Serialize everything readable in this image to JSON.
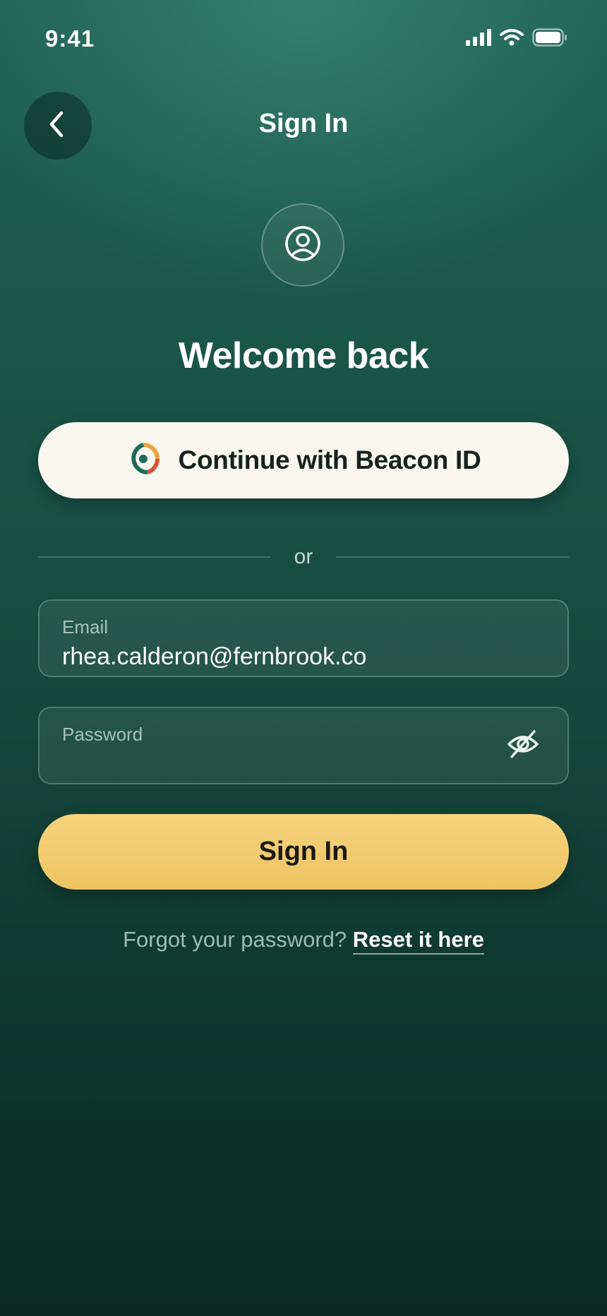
{
  "status_bar": {
    "time": "9:41",
    "icons": [
      "cellular-signal-icon",
      "wifi-icon",
      "battery-icon"
    ]
  },
  "header": {
    "title": "Sign In",
    "back_icon": "chevron-left-icon"
  },
  "avatar": {
    "icon": "user-circle-icon"
  },
  "welcome": "Welcome back",
  "beacon_button": {
    "label": "Continue with Beacon ID",
    "icon": "beacon-ring-logo-icon"
  },
  "divider": {
    "label": "or"
  },
  "email_field": {
    "label": "Email",
    "value": "rhea.calderon@fernbrook.co"
  },
  "password_field": {
    "label": "Password",
    "value": "",
    "toggle_icon": "eye-off-icon"
  },
  "primary_button": {
    "label": "Sign In"
  },
  "forgot": {
    "text": "Forgot your password?",
    "link": "Reset it here"
  },
  "colors": {
    "background_top": "#1f6152",
    "background_bottom": "#0b2a24",
    "primary_button": "#f2c96e",
    "secondary_button": "#faf7f1",
    "beacon_ring_teal": "#1e6b5c",
    "beacon_ring_red": "#d9533d",
    "beacon_ring_amber": "#e8a33a"
  }
}
